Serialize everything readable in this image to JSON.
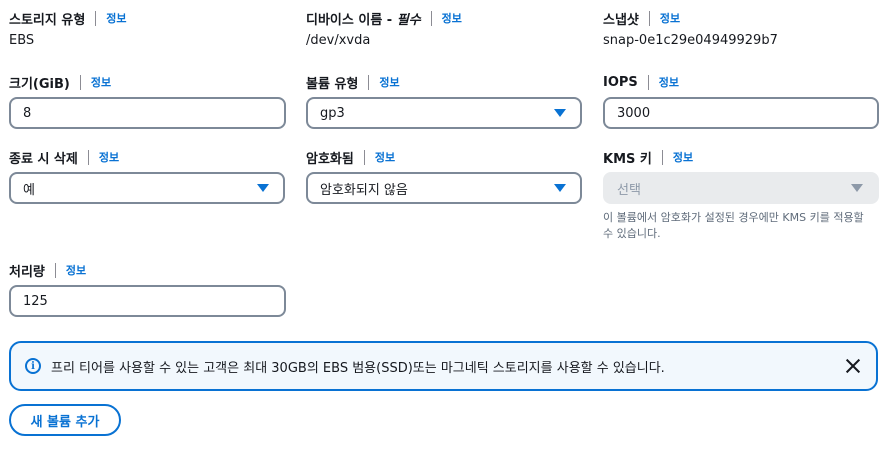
{
  "info_label": "정보",
  "row1": {
    "storage_type": {
      "label": "스토리지 유형",
      "value": "EBS"
    },
    "device_name": {
      "label_prefix": "디바이스 이름 - ",
      "label_italic": "필수",
      "value": "/dev/xvda"
    },
    "snapshot": {
      "label": "스냅샷",
      "value": "snap-0e1c29e04949929b7"
    }
  },
  "row2": {
    "size": {
      "label": "크기(GiB)",
      "value": "8"
    },
    "volume_type": {
      "label": "볼륨 유형",
      "value": "gp3"
    },
    "iops": {
      "label": "IOPS",
      "value": "3000"
    }
  },
  "row3": {
    "delete_on_termination": {
      "label": "종료 시 삭제",
      "value": "예"
    },
    "encrypted": {
      "label": "암호화됨",
      "value": "암호화되지 않음"
    },
    "kms_key": {
      "label": "KMS 키",
      "placeholder": "선택",
      "hint": "이 볼륨에서 암호화가 설정된 경우에만 KMS 키를 적용할 수 있습니다."
    }
  },
  "row4": {
    "throughput": {
      "label": "처리량",
      "value": "125"
    }
  },
  "alert": {
    "icon": "info-icon",
    "text": "프리 티어를 사용할 수 있는 고객은 최대 30GB의 EBS 범용(SSD)또는 마그네틱 스토리지를 사용할 수 있습니다."
  },
  "add_volume_label": "새 볼륨 추가",
  "colors": {
    "accent": "#0972d3",
    "text": "#16191f",
    "alert_bg": "#f2f8fd",
    "disabled": "#e9ebed"
  }
}
